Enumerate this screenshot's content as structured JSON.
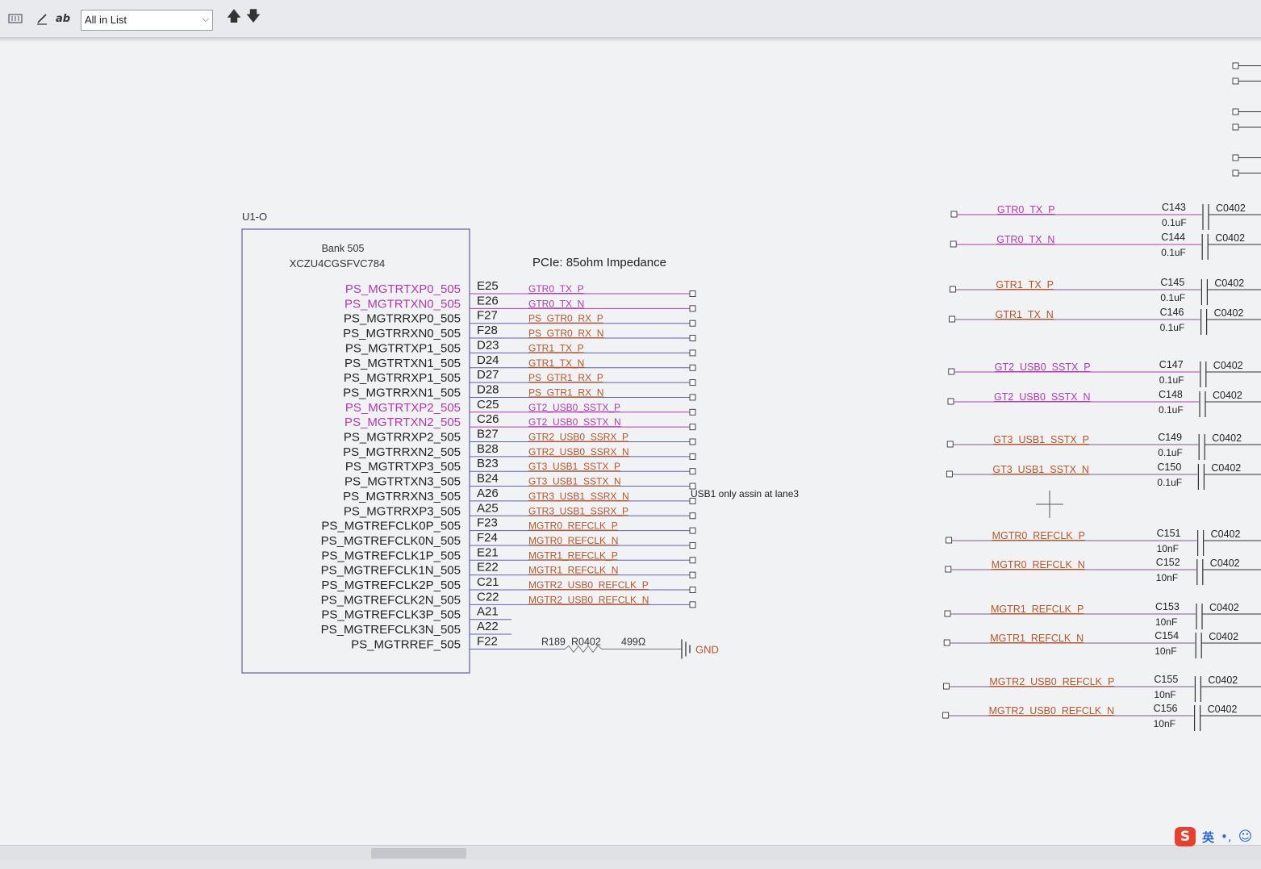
{
  "toolbar": {
    "find_scope": "All in List",
    "text_tool_label": "ab"
  },
  "schematic": {
    "part": {
      "ref": "U1-O",
      "bank": "Bank 505",
      "device": "XCZU4CGSFVC784"
    },
    "impedance_note": "PCIe: 85ohm Impedance",
    "lane_note": "USB1 only assin at lane3",
    "pins": [
      {
        "name": "PS_MGTRTXP0_505",
        "num": "E25",
        "net": "GTR0_TX_P",
        "kind": "tx"
      },
      {
        "name": "PS_MGTRTXN0_505",
        "num": "E26",
        "net": "GTR0_TX_N",
        "kind": "tx"
      },
      {
        "name": "PS_MGTRRXP0_505",
        "num": "F27",
        "net": "PS_GTR0_RX_P",
        "kind": "rx"
      },
      {
        "name": "PS_MGTRRXN0_505",
        "num": "F28",
        "net": "PS_GTR0_RX_N",
        "kind": "rx"
      },
      {
        "name": "PS_MGTRTXP1_505",
        "num": "D23",
        "net": "GTR1_TX_P",
        "kind": "rx"
      },
      {
        "name": "PS_MGTRTXN1_505",
        "num": "D24",
        "net": "GTR1_TX_N",
        "kind": "rx"
      },
      {
        "name": "PS_MGTRRXP1_505",
        "num": "D27",
        "net": "PS_GTR1_RX_P",
        "kind": "rx"
      },
      {
        "name": "PS_MGTRRXN1_505",
        "num": "D28",
        "net": "PS_GTR1_RX_N",
        "kind": "rx"
      },
      {
        "name": "PS_MGTRTXP2_505",
        "num": "C25",
        "net": "GT2_USB0_SSTX_P",
        "kind": "tx"
      },
      {
        "name": "PS_MGTRTXN2_505",
        "num": "C26",
        "net": "GT2_USB0_SSTX_N",
        "kind": "tx"
      },
      {
        "name": "PS_MGTRRXP2_505",
        "num": "B27",
        "net": "GTR2_USB0_SSRX_P",
        "kind": "rx"
      },
      {
        "name": "PS_MGTRRXN2_505",
        "num": "B28",
        "net": "GTR2_USB0_SSRX_N",
        "kind": "rx"
      },
      {
        "name": "PS_MGTRTXP3_505",
        "num": "B23",
        "net": "GT3_USB1_SSTX_P",
        "kind": "rx"
      },
      {
        "name": "PS_MGTRTXN3_505",
        "num": "B24",
        "net": "GT3_USB1_SSTX_N",
        "kind": "rx"
      },
      {
        "name": "PS_MGTRRXN3_505",
        "num": "A26",
        "net": "GTR3_USB1_SSRX_N",
        "kind": "rx"
      },
      {
        "name": "PS_MGTRRXP3_505",
        "num": "A25",
        "net": "GTR3_USB1_SSRX_P",
        "kind": "rx"
      },
      {
        "name": "PS_MGTREFCLK0P_505",
        "num": "F23",
        "net": "MGTR0_REFCLK_P",
        "kind": "rx"
      },
      {
        "name": "PS_MGTREFCLK0N_505",
        "num": "F24",
        "net": "MGTR0_REFCLK_N",
        "kind": "rx"
      },
      {
        "name": "PS_MGTREFCLK1P_505",
        "num": "E21",
        "net": "MGTR1_REFCLK_P",
        "kind": "rx"
      },
      {
        "name": "PS_MGTREFCLK1N_505",
        "num": "E22",
        "net": "MGTR1_REFCLK_N",
        "kind": "rx"
      },
      {
        "name": "PS_MGTREFCLK2P_505",
        "num": "C21",
        "net": "MGTR2_USB0_REFCLK_P",
        "kind": "rx"
      },
      {
        "name": "PS_MGTREFCLK2N_505",
        "num": "C22",
        "net": "MGTR2_USB0_REFCLK_N",
        "kind": "rx"
      },
      {
        "name": "PS_MGTREFCLK3P_505",
        "num": "A21",
        "net": "",
        "kind": "nc"
      },
      {
        "name": "PS_MGTREFCLK3N_505",
        "num": "A22",
        "net": "",
        "kind": "nc"
      },
      {
        "name": "PS_MGTRREF_505",
        "num": "F22",
        "net": "",
        "kind": "ref"
      }
    ],
    "resistor": {
      "ref": "R189",
      "footprint": "R0402",
      "value": "499Ω",
      "gnd": "GND"
    },
    "caps": [
      {
        "net": "GTR0_TX_P",
        "ref": "C143",
        "value": "0.1uF",
        "fp": "C0402",
        "kind": "tx"
      },
      {
        "net": "GTR0_TX_N",
        "ref": "C144",
        "value": "0.1uF",
        "fp": "C0402",
        "kind": "tx"
      },
      {
        "net": "GTR1_TX_P",
        "ref": "C145",
        "value": "0.1uF",
        "fp": "C0402",
        "kind": "rx"
      },
      {
        "net": "GTR1_TX_N",
        "ref": "C146",
        "value": "0.1uF",
        "fp": "C0402",
        "kind": "rx"
      },
      {
        "net": "GT2_USB0_SSTX_P",
        "ref": "C147",
        "value": "0.1uF",
        "fp": "C0402",
        "kind": "tx"
      },
      {
        "net": "GT2_USB0_SSTX_N",
        "ref": "C148",
        "value": "0.1uF",
        "fp": "C0402",
        "kind": "tx"
      },
      {
        "net": "GT3_USB1_SSTX_P",
        "ref": "C149",
        "value": "0.1uF",
        "fp": "C0402",
        "kind": "rx"
      },
      {
        "net": "GT3_USB1_SSTX_N",
        "ref": "C150",
        "value": "0.1uF",
        "fp": "C0402",
        "kind": "rx"
      },
      {
        "net": "MGTR0_REFCLK_P",
        "ref": "C151",
        "value": "10nF",
        "fp": "C0402",
        "kind": "rx"
      },
      {
        "net": "MGTR0_REFCLK_N",
        "ref": "C152",
        "value": "10nF",
        "fp": "C0402",
        "kind": "rx"
      },
      {
        "net": "MGTR1_REFCLK_P",
        "ref": "C153",
        "value": "10nF",
        "fp": "C0402",
        "kind": "rx"
      },
      {
        "net": "MGTR1_REFCLK_N",
        "ref": "C154",
        "value": "10nF",
        "fp": "C0402",
        "kind": "rx"
      },
      {
        "net": "MGTR2_USB0_REFCLK_P",
        "ref": "C155",
        "value": "10nF",
        "fp": "C0402",
        "kind": "rx"
      },
      {
        "net": "MGTR2_USB0_REFCLK_N",
        "ref": "C156",
        "value": "10nF",
        "fp": "C0402",
        "kind": "rx"
      }
    ]
  },
  "ime": {
    "logo": "S",
    "lang": "英",
    "punct": "•,",
    "emoji": "☺"
  },
  "colors": {
    "tx": "#b23ab0",
    "rx": "#b5562b",
    "line": "#5f5fb0",
    "pin": "#222222",
    "box": "#6a6aa8"
  }
}
